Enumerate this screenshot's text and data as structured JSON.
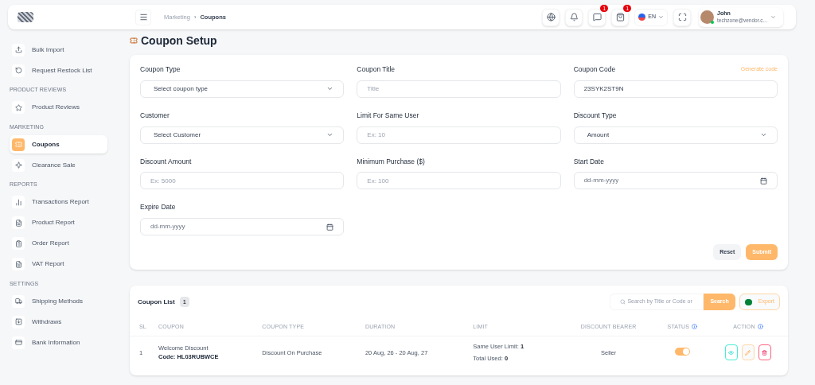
{
  "header": {
    "breadcrumb": [
      {
        "label": "Marketing",
        "selected": false
      },
      {
        "label": "Coupons",
        "selected": true
      }
    ],
    "separator": "›",
    "badges": {
      "messages": "1",
      "orders": "1"
    },
    "language": "EN",
    "user": {
      "name": "John",
      "email": "techzone@vendor.c...",
      "online": true
    }
  },
  "sidebar": {
    "sections": [
      {
        "items": [
          {
            "label": "Bulk Import",
            "selected": false
          },
          {
            "label": "Request Restock List",
            "selected": false
          }
        ]
      },
      {
        "heading": "PRODUCT REVIEWS",
        "items": [
          {
            "label": "Product Reviews",
            "selected": false
          }
        ]
      },
      {
        "heading": "MARKETING",
        "items": [
          {
            "label": "Coupons",
            "selected": true
          },
          {
            "label": "Clearance Sale",
            "selected": false
          }
        ]
      },
      {
        "heading": "REPORTS",
        "items": [
          {
            "label": "Transactions Report",
            "selected": false
          },
          {
            "label": "Product Report",
            "selected": false
          },
          {
            "label": "Order Report",
            "selected": false
          },
          {
            "label": "VAT Report",
            "selected": false
          }
        ]
      },
      {
        "heading": "SETTINGS",
        "items": [
          {
            "label": "Shipping Methods",
            "selected": false
          },
          {
            "label": "Withdraws",
            "selected": false
          },
          {
            "label": "Bank Information",
            "selected": false
          }
        ]
      }
    ]
  },
  "page_title": "Coupon Setup",
  "form": {
    "fields": [
      {
        "kind": "select",
        "label": "Coupon Type",
        "value": "Select coupon type"
      },
      {
        "kind": "text",
        "label": "Coupon Title",
        "placeholder": "Title"
      },
      {
        "kind": "text",
        "label": "Coupon Code",
        "value": "23SYK2ST9N",
        "link": "Generate code"
      },
      {
        "kind": "select",
        "label": "Customer",
        "value": "Select Customer"
      },
      {
        "kind": "text",
        "label": "Limit For Same User",
        "placeholder": "Ex: 10"
      },
      {
        "kind": "select",
        "label": "Discount Type",
        "value": "Amount"
      },
      {
        "kind": "text",
        "label": "Discount Amount",
        "placeholder": "Ex: 5000"
      },
      {
        "kind": "text",
        "label": "Minimum Purchase ($)",
        "placeholder": "Ex: 100"
      },
      {
        "kind": "date",
        "label": "Start Date",
        "placeholder": "dd-mm-yyyy"
      },
      {
        "kind": "date",
        "label": "Expire Date",
        "placeholder": "dd-mm-yyyy"
      }
    ],
    "buttons": [
      {
        "label": "Reset",
        "kind": "secondary"
      },
      {
        "label": "Submit",
        "kind": "primary"
      }
    ]
  },
  "coupon_list": {
    "title": "Coupon List",
    "count": "1",
    "search": {
      "placeholder": "Search by Title or Code or",
      "button": "Search"
    },
    "export": "Export",
    "columns": [
      {
        "label": "SL",
        "info": false
      },
      {
        "label": "COUPON",
        "info": false
      },
      {
        "label": "COUPON TYPE",
        "info": false
      },
      {
        "label": "DURATION",
        "info": false
      },
      {
        "label": "LIMIT",
        "info": false
      },
      {
        "label": "DISCOUNT BEARER",
        "info": false
      },
      {
        "label": "STATUS",
        "info": true
      },
      {
        "label": "ACTION",
        "info": true
      }
    ],
    "rows": [
      {
        "sl": "1",
        "name": "Welcome Discount",
        "code_label": "Code:",
        "code": "HL03RUBWCE",
        "type": "Discount On Purchase",
        "duration": "20 Aug, 26 - 20 Aug, 27",
        "limit_label": "Same User Limit:",
        "limit": "1",
        "used_label": "Total Used:",
        "used": "0",
        "bearer": "Seller",
        "status_on": true
      }
    ]
  }
}
